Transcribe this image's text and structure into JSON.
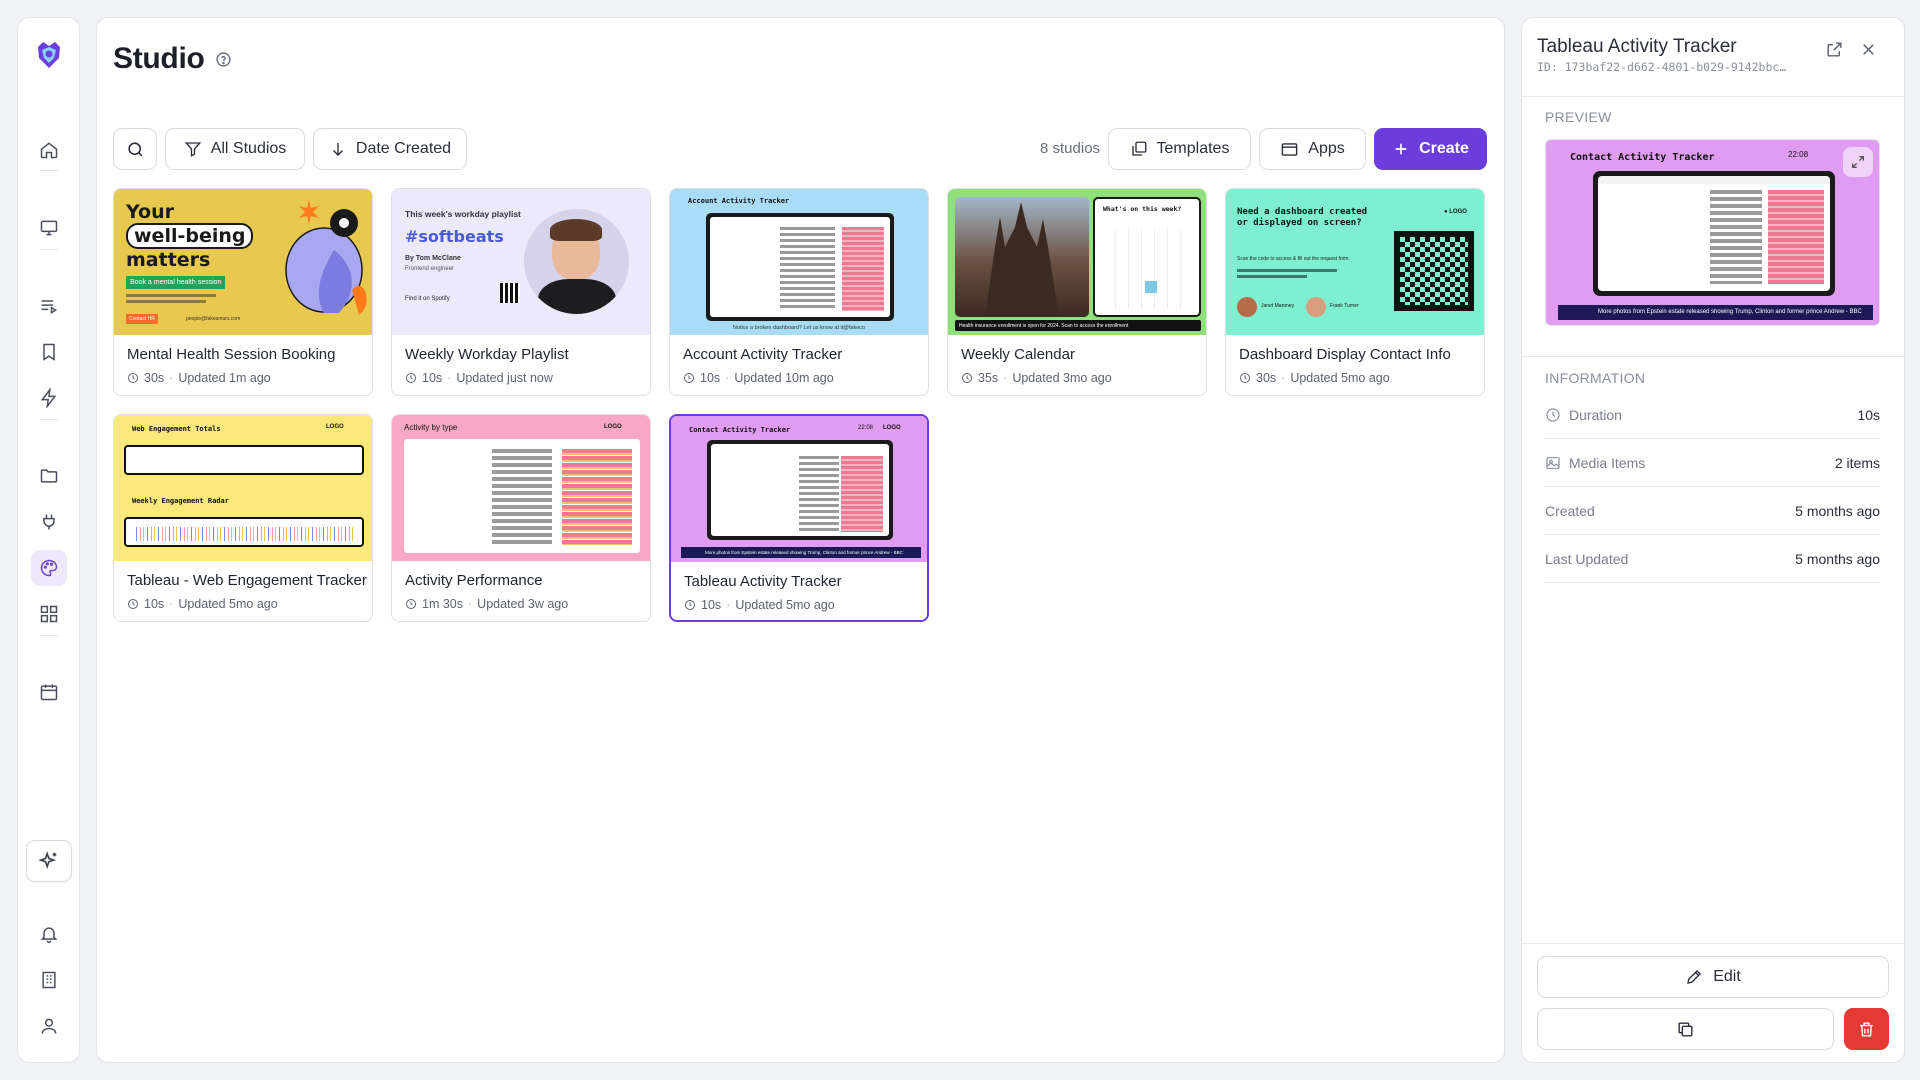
{
  "page": {
    "title": "Studio"
  },
  "toolbar": {
    "filter_label": "All Studios",
    "sort_label": "Date Created",
    "count": "8 studios",
    "templates_label": "Templates",
    "apps_label": "Apps",
    "create_label": "Create"
  },
  "studios": [
    {
      "title": "Mental Health Session Booking",
      "duration": "30s",
      "updated": "Updated 1m ago"
    },
    {
      "title": "Weekly Workday Playlist",
      "duration": "10s",
      "updated": "Updated just now"
    },
    {
      "title": "Account Activity Tracker",
      "duration": "10s",
      "updated": "Updated 10m ago"
    },
    {
      "title": "Weekly Calendar",
      "duration": "35s",
      "updated": "Updated 3mo ago"
    },
    {
      "title": "Dashboard Display Contact Info",
      "duration": "30s",
      "updated": "Updated 5mo ago"
    },
    {
      "title": "Tableau - Web Engagement Tracker",
      "duration": "10s",
      "updated": "Updated 5mo ago"
    },
    {
      "title": "Activity Performance",
      "duration": "1m 30s",
      "updated": "Updated 3w ago"
    },
    {
      "title": "Tableau Activity Tracker",
      "duration": "10s",
      "updated": "Updated 5mo ago"
    }
  ],
  "thumbs": {
    "mental": {
      "line1": "Your",
      "line2": "well-being",
      "line3": "matters",
      "cta": "Book a mental health session",
      "email": "people@fakeamurs.com"
    },
    "playlist": {
      "heading": "This week's workday playlist",
      "tag": "#softbeats",
      "by": "By Tom McClane",
      "role": "Frontend engineer",
      "find": "Find it on Spotify"
    },
    "account": {
      "heading": "Account Activity Tracker",
      "footer": "Notice a broken dashboard? Let us know at it@fakeco"
    },
    "calendar": {
      "heading": "What's on this week?",
      "footer": "Health insurance enrollment is open for 2024. Scan to access the enrollment"
    },
    "contact": {
      "heading": "Need a dashboard created or displayed on screen?",
      "sub": "Scan the code to access & fill out the request form.",
      "name1": "Janet Maroney",
      "name2": "Frank Turner"
    },
    "web": {
      "heading1": "Web Engagement Totals",
      "heading2": "Weekly Engagement Radar",
      "logo": "LOGO"
    },
    "activity": {
      "heading": "Activity by type",
      "logo": "LOGO"
    },
    "tableau": {
      "heading": "Contact Activity Tracker",
      "time": "22:08",
      "logo": "LOGO",
      "ticker": "More photos from Epstein estate released showing Trump, Clinton and former prince Andrew - BBC"
    }
  },
  "panel": {
    "title": "Tableau Activity Tracker",
    "id": "ID: 173baf22-d662-4801-b029-9142bbc…",
    "preview_label": "PREVIEW",
    "info_label": "INFORMATION",
    "rows": [
      {
        "key": "Duration",
        "value": "10s"
      },
      {
        "key": "Media Items",
        "value": "2 items"
      },
      {
        "key": "Created",
        "value": "5 months ago"
      },
      {
        "key": "Last Updated",
        "value": "5 months ago"
      }
    ],
    "edit_label": "Edit"
  },
  "colors": {
    "accent": "#6b3ddc",
    "danger": "#e53935"
  }
}
